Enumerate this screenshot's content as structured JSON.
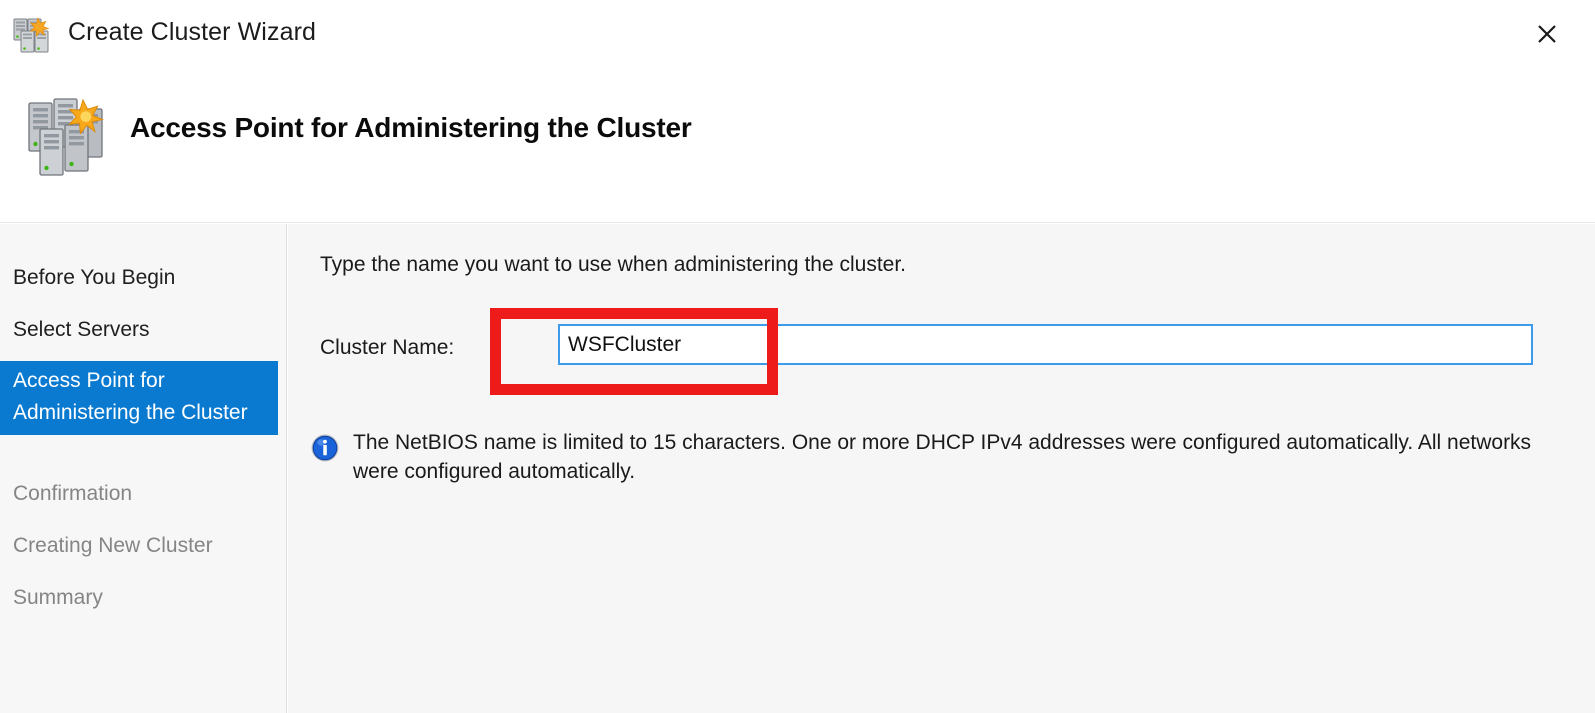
{
  "window": {
    "title": "Create Cluster Wizard",
    "title_icon": "cluster-servers-icon",
    "close_label": "✕"
  },
  "banner": {
    "heading": "Access Point for Administering the Cluster",
    "icon": "cluster-servers-large-icon"
  },
  "sidebar": {
    "items": [
      {
        "label": "Before You Begin",
        "state": "visited"
      },
      {
        "label": "Select Servers",
        "state": "visited"
      },
      {
        "label": "Access Point for Administering the Cluster",
        "state": "active"
      },
      {
        "label": "Confirmation",
        "state": "disabled"
      },
      {
        "label": "Creating New Cluster",
        "state": "disabled"
      },
      {
        "label": "Summary",
        "state": "disabled"
      }
    ]
  },
  "main": {
    "instruction": "Type the name you want to use when administering the cluster.",
    "cluster_name_label": "Cluster Name:",
    "cluster_name_value": "WSFCluster",
    "cluster_name_placeholder": "",
    "info_icon": "info-circle-icon",
    "info_message": "The NetBIOS name is limited to 15 characters.  One or more DHCP IPv4 addresses were configured automatically.  All networks were configured automatically."
  },
  "annotation": {
    "type": "red-rectangle-highlight",
    "color": "#ee1b1b"
  },
  "colors": {
    "accent_blue": "#0a7ad1",
    "input_border": "#3d9be9",
    "annotation_red": "#ee1b1b",
    "content_bg": "#f6f6f6",
    "sidebar_bg": "#f7f7f7",
    "disabled_text": "#858585"
  }
}
